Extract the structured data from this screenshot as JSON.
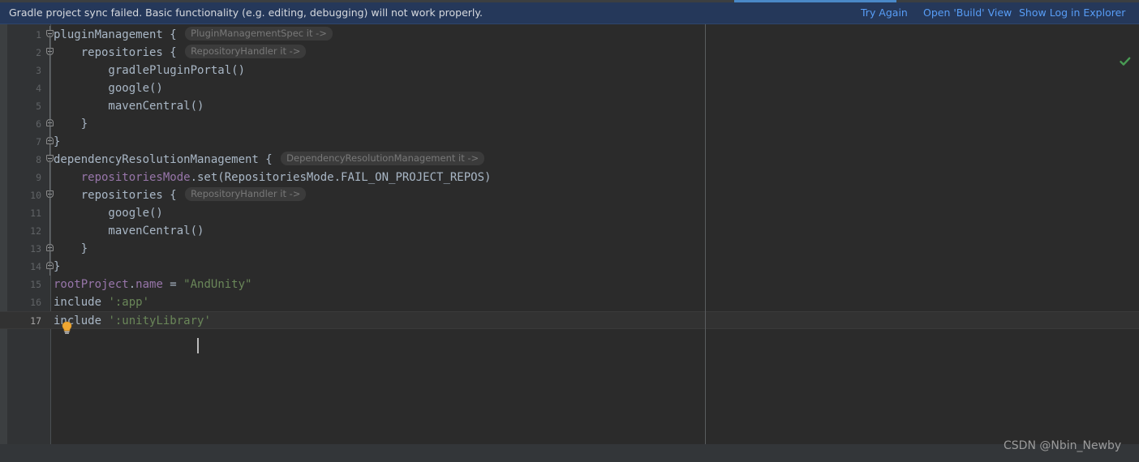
{
  "notification": {
    "message": "Gradle project sync failed. Basic functionality (e.g. editing, debugging) will not work properly.",
    "links": [
      {
        "label": "Try Again"
      },
      {
        "label": "Open 'Build' View"
      },
      {
        "label": "Show Log in Explorer"
      }
    ],
    "background_color": "#25385a",
    "link_color": "#589df6",
    "progress": {
      "fill_color": "#4a88c7",
      "track_color": "#3c3f41"
    }
  },
  "editor": {
    "background_color": "#2b2b2b",
    "gutter_color": "#313335",
    "current_line": 17,
    "caret_line": 17,
    "lines": [
      {
        "number": "1",
        "segments": [
          {
            "text": "pluginManagement { ",
            "type": "plain"
          },
          {
            "text": "PluginManagementSpec it ->",
            "type": "inlay"
          }
        ],
        "indent": 0
      },
      {
        "number": "2",
        "segments": [
          {
            "text": "    repositories { ",
            "type": "plain"
          },
          {
            "text": "RepositoryHandler it ->",
            "type": "inlay"
          }
        ],
        "indent": 1
      },
      {
        "number": "3",
        "segments": [
          {
            "text": "        gradlePluginPortal()",
            "type": "plain"
          }
        ]
      },
      {
        "number": "4",
        "segments": [
          {
            "text": "        google()",
            "type": "plain"
          }
        ]
      },
      {
        "number": "5",
        "segments": [
          {
            "text": "        mavenCentral()",
            "type": "plain"
          }
        ]
      },
      {
        "number": "6",
        "segments": [
          {
            "text": "    }",
            "type": "plain"
          }
        ]
      },
      {
        "number": "7",
        "segments": [
          {
            "text": "}",
            "type": "plain"
          }
        ]
      },
      {
        "number": "8",
        "segments": [
          {
            "text": "dependencyResolutionManagement { ",
            "type": "plain"
          },
          {
            "text": "DependencyResolutionManagement it ->",
            "type": "inlay"
          }
        ]
      },
      {
        "number": "9",
        "segments": [
          {
            "text": "    repositoriesMode",
            "type": "ident"
          },
          {
            "text": ".set(RepositoriesMode.FAIL_ON_PROJECT_REPOS)",
            "type": "plain"
          }
        ]
      },
      {
        "number": "10",
        "segments": [
          {
            "text": "    repositories { ",
            "type": "plain"
          },
          {
            "text": "RepositoryHandler it ->",
            "type": "inlay"
          }
        ]
      },
      {
        "number": "11",
        "segments": [
          {
            "text": "        google()",
            "type": "plain"
          }
        ]
      },
      {
        "number": "12",
        "segments": [
          {
            "text": "        mavenCentral()",
            "type": "plain"
          }
        ]
      },
      {
        "number": "13",
        "segments": [
          {
            "text": "    }",
            "type": "plain"
          }
        ]
      },
      {
        "number": "14",
        "segments": [
          {
            "text": "}",
            "type": "plain"
          }
        ]
      },
      {
        "number": "15",
        "segments": [
          {
            "text": "rootProject",
            "type": "ident"
          },
          {
            "text": ".",
            "type": "plain"
          },
          {
            "text": "name",
            "type": "ident"
          },
          {
            "text": " = ",
            "type": "plain"
          },
          {
            "text": "\"AndUnity\"",
            "type": "str"
          }
        ]
      },
      {
        "number": "16",
        "segments": [
          {
            "text": "include ",
            "type": "plain"
          },
          {
            "text": "':app'",
            "type": "str"
          }
        ]
      },
      {
        "number": "17",
        "segments": [
          {
            "text": "include ",
            "type": "plain"
          },
          {
            "text": "':unityLibrary'",
            "type": "str"
          }
        ]
      }
    ],
    "fold_markers": [
      {
        "line": 1,
        "kind": "top"
      },
      {
        "line": 2,
        "kind": "top"
      },
      {
        "line": 6,
        "kind": "bottom"
      },
      {
        "line": 7,
        "kind": "bottom"
      },
      {
        "line": 8,
        "kind": "top"
      },
      {
        "line": 10,
        "kind": "top"
      },
      {
        "line": 13,
        "kind": "bottom"
      },
      {
        "line": 14,
        "kind": "bottom"
      }
    ],
    "colors": {
      "string": "#6a8759",
      "identifier": "#9876aa",
      "plain_text": "#a9b7c6",
      "inlay_hint_text": "#787878",
      "line_number": "#606366"
    }
  },
  "status": {
    "inspection_icon": "green-check-icon",
    "inspection_color": "#499c54"
  },
  "watermark": {
    "text": "CSDN @Nbin_Newby"
  }
}
